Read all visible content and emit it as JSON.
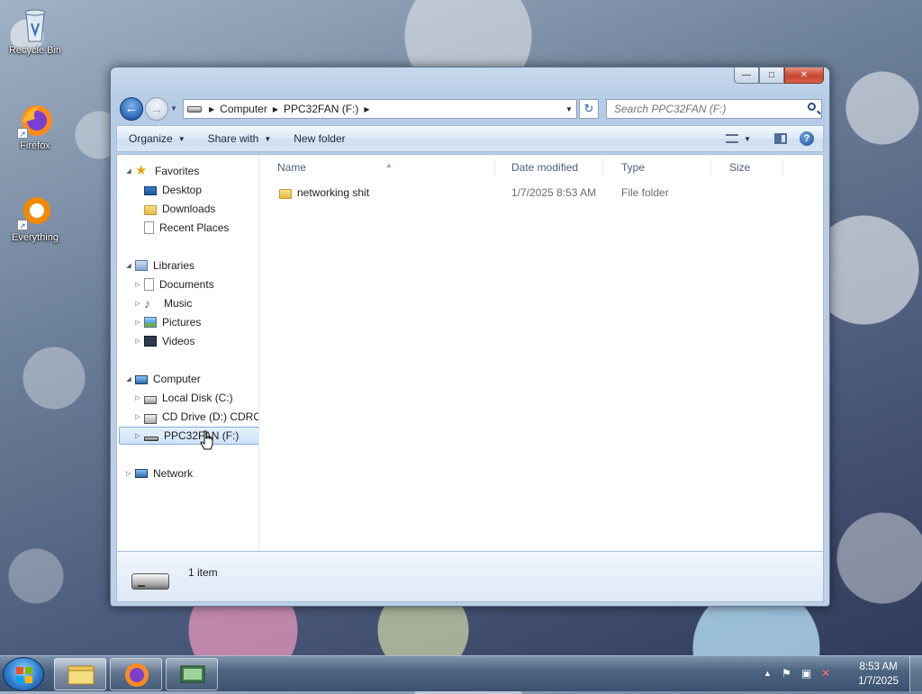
{
  "desktop": {
    "icons": [
      {
        "label": "Recycle Bin"
      },
      {
        "label": "Firefox"
      },
      {
        "label": "Everything"
      }
    ]
  },
  "window": {
    "caption_buttons": {
      "minimize": "—",
      "maximize": "□",
      "close": "✕"
    },
    "address": {
      "crumbs": [
        "Computer",
        "PPC32FAN (F:)"
      ]
    },
    "search": {
      "placeholder": "Search PPC32FAN (F:)"
    },
    "toolbar": {
      "organize": "Organize",
      "share_with": "Share with",
      "new_folder": "New folder"
    },
    "nav": {
      "favorites": {
        "label": "Favorites",
        "items": [
          "Desktop",
          "Downloads",
          "Recent Places"
        ]
      },
      "libraries": {
        "label": "Libraries",
        "items": [
          "Documents",
          "Music",
          "Pictures",
          "Videos"
        ]
      },
      "computer": {
        "label": "Computer",
        "items": [
          "Local Disk (C:)",
          "CD Drive (D:) CDROM",
          "PPC32FAN (F:)"
        ]
      },
      "network": {
        "label": "Network"
      }
    },
    "columns": [
      "Name",
      "Date modified",
      "Type",
      "Size"
    ],
    "files": [
      {
        "name": "networking shit",
        "date_modified": "1/7/2025 8:53 AM",
        "type": "File folder",
        "size": ""
      }
    ],
    "details": {
      "item_count": "1 item"
    }
  },
  "taskbar": {
    "clock": {
      "time": "8:53 AM",
      "date": "1/7/2025"
    }
  },
  "colors": {
    "accent": "#2a67b6",
    "selection": "#cde3fb",
    "folder": "#e4b844"
  }
}
